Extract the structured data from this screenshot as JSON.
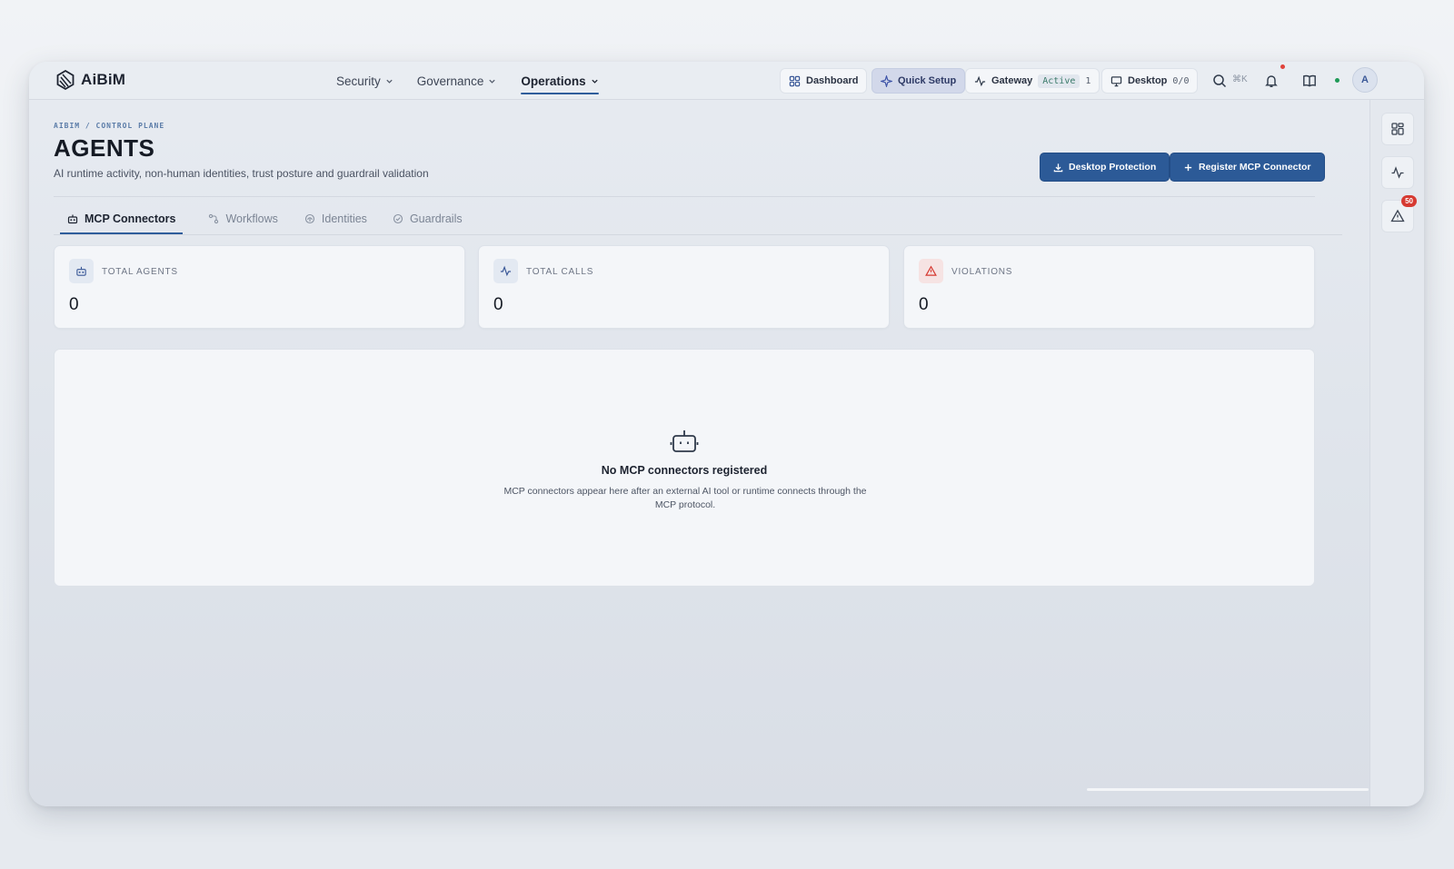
{
  "app": {
    "name": "AiBiM"
  },
  "nav": [
    {
      "label": "Security",
      "active": false
    },
    {
      "label": "Governance",
      "active": false
    },
    {
      "label": "Operations",
      "active": true
    }
  ],
  "topbar": {
    "dashboard_label": "Dashboard",
    "quick_setup_label": "Quick Setup",
    "gateway_label": "Gateway",
    "gateway_status": "Active",
    "gateway_count": "1",
    "desktop_label": "Desktop",
    "desktop_count": "0/0",
    "search_shortcut": "⌘K",
    "avatar_initial": "A"
  },
  "rail": {
    "alerts_badge": "50"
  },
  "header": {
    "breadcrumb": "AIBIM / CONTROL PLANE",
    "title": "AGENTS",
    "subtitle": "AI runtime activity, non-human identities, trust posture and guardrail validation",
    "desktop_protection_label": "Desktop Protection",
    "register_label": "Register MCP Connector"
  },
  "tabs": [
    {
      "label": "MCP Connectors",
      "active": true
    },
    {
      "label": "Workflows",
      "active": false
    },
    {
      "label": "Identities",
      "active": false
    },
    {
      "label": "Guardrails",
      "active": false
    }
  ],
  "stats": [
    {
      "label": "TOTAL AGENTS",
      "value": "0"
    },
    {
      "label": "TOTAL CALLS",
      "value": "0"
    },
    {
      "label": "VIOLATIONS",
      "value": "0"
    }
  ],
  "empty_state": {
    "title": "No MCP connectors registered",
    "description": "MCP connectors appear here after an external AI tool or runtime connects through the MCP protocol."
  },
  "colors": {
    "accent": "#2c5a97",
    "active_pill_text": "#3a7a6a",
    "alert_red": "#d63a32",
    "status_green": "#1f9a57"
  }
}
